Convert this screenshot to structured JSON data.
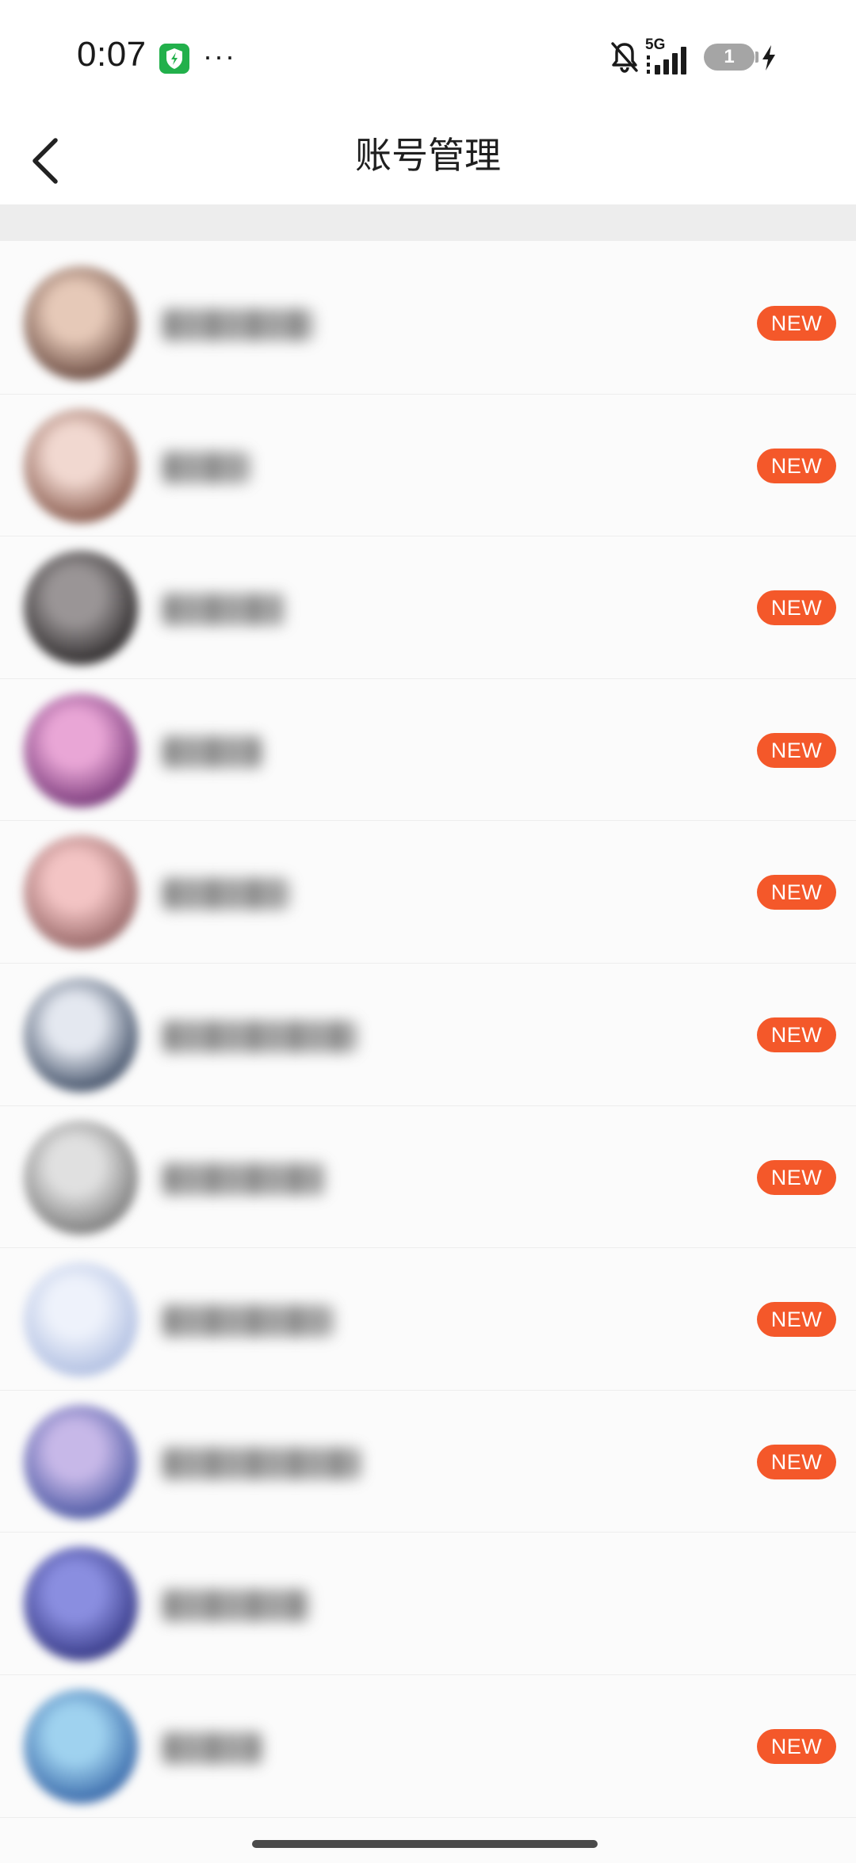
{
  "status_bar": {
    "time": "0:07",
    "more": "···",
    "network": "5G",
    "battery_level": "1",
    "icons": [
      "security-shield-icon",
      "mute-bell-icon",
      "signal-icon",
      "battery-icon",
      "charging-bolt-icon"
    ]
  },
  "header": {
    "title": "账号管理",
    "back_icon": "chevron-left-icon"
  },
  "accounts": [
    {
      "has_new": true,
      "badge": "NEW",
      "avatar_colors": [
        "#e6c9b8",
        "#5b3b32"
      ]
    },
    {
      "has_new": true,
      "badge": "NEW",
      "avatar_colors": [
        "#f1d8d0",
        "#7b4a3c"
      ]
    },
    {
      "has_new": true,
      "badge": "NEW",
      "avatar_colors": [
        "#9a9596",
        "#1f1c1d"
      ]
    },
    {
      "has_new": true,
      "badge": "NEW",
      "avatar_colors": [
        "#e9a6d6",
        "#6a2a6e"
      ]
    },
    {
      "has_new": true,
      "badge": "NEW",
      "avatar_colors": [
        "#f3c4c4",
        "#8a5a5a"
      ]
    },
    {
      "has_new": true,
      "badge": "NEW",
      "avatar_colors": [
        "#e4e8f0",
        "#2b3b55"
      ]
    },
    {
      "has_new": true,
      "badge": "NEW",
      "avatar_colors": [
        "#e0e0e0",
        "#6f6f6f"
      ]
    },
    {
      "has_new": true,
      "badge": "NEW",
      "avatar_colors": [
        "#eef2fb",
        "#a8b8de"
      ]
    },
    {
      "has_new": true,
      "badge": "NEW",
      "avatar_colors": [
        "#c7b8e8",
        "#3a4a9a"
      ]
    },
    {
      "has_new": false,
      "badge": "",
      "avatar_colors": [
        "#8a8ee0",
        "#2a2d7a"
      ]
    },
    {
      "has_new": true,
      "badge": "NEW",
      "avatar_colors": [
        "#9fd2ef",
        "#2a5aa0"
      ]
    }
  ],
  "colors": {
    "accent_badge": "#f4582a",
    "background": "#fbfbfb",
    "separator": "#ededed"
  }
}
